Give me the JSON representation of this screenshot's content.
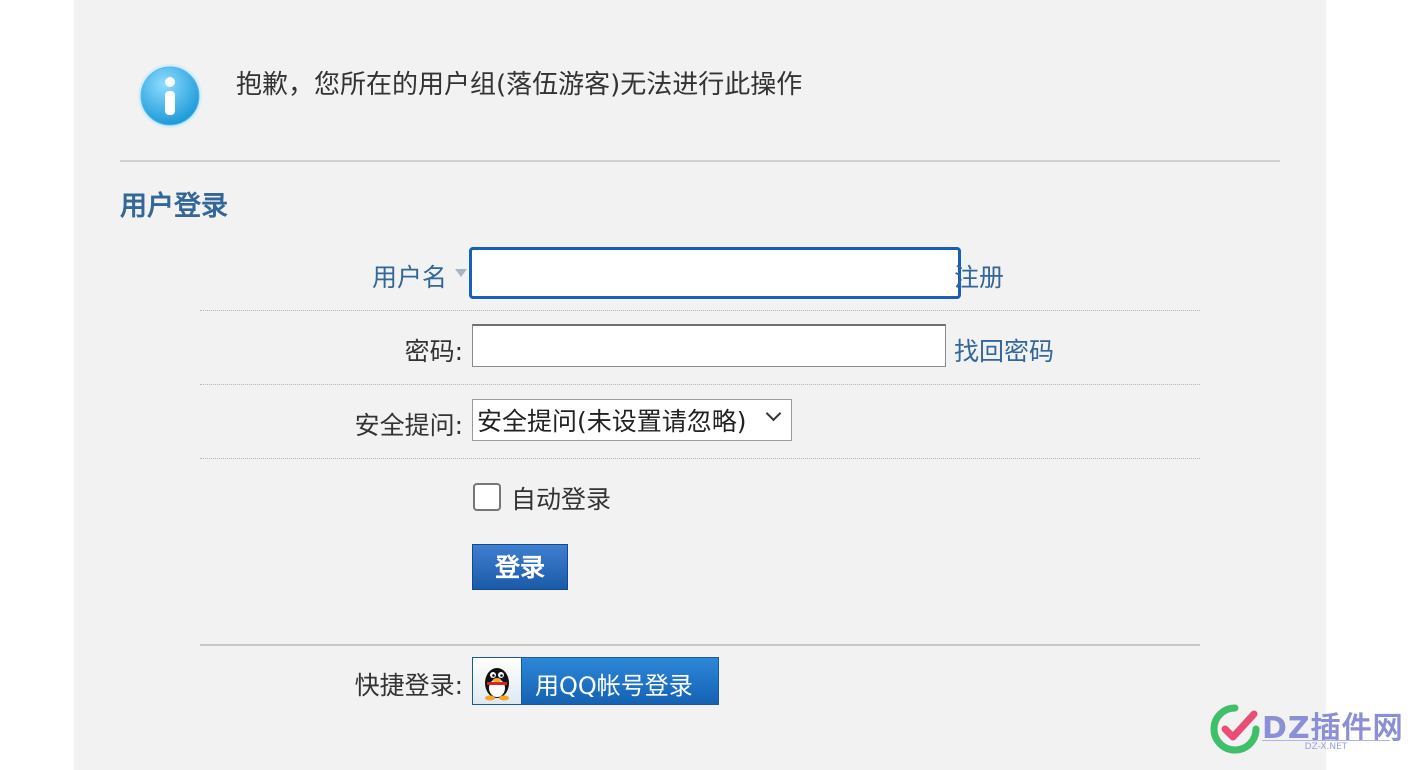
{
  "alert": {
    "icon": "info-icon",
    "message": "抱歉，您所在的用户组(落伍游客)无法进行此操作"
  },
  "login": {
    "title": "用户登录",
    "username_label": "用户名",
    "username_value": "",
    "register_link": "注册",
    "password_label": "密码:",
    "password_value": "",
    "forgot_link": "找回密码",
    "question_label": "安全提问:",
    "question_selected": "安全提问(未设置请忽略)",
    "autologin_label": "自动登录",
    "autologin_checked": false,
    "submit_label": "登录",
    "quick_label": "快捷登录:",
    "qq_button_label": "用QQ帐号登录"
  },
  "watermark": {
    "brand": "DZ插件网",
    "domain": "DZ-X.NET"
  },
  "colors": {
    "accent": "#336699",
    "button": "#1b5aa8",
    "panel": "#f2f2f2"
  }
}
